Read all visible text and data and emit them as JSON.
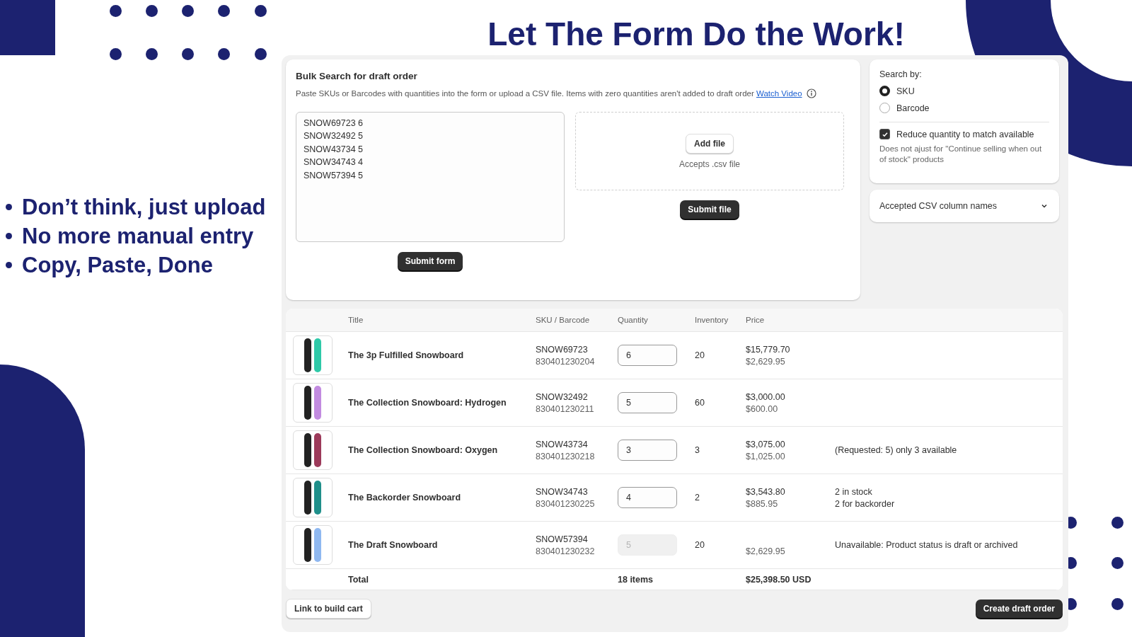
{
  "headline": "Let The Form Do the Work!",
  "bullets": [
    "Don’t think, just upload",
    "No more manual entry",
    "Copy, Paste, Done"
  ],
  "form_card": {
    "title": "Bulk Search for draft order",
    "description": "Paste SKUs or Barcodes with quantities into the form or upload a CSV file. Items with zero quantities aren't added to draft order",
    "link": "Watch Video",
    "textarea_lines": [
      "SNOW69723 6",
      "SNOW32492 5",
      "SNOW43734 5",
      "SNOW34743 4",
      "SNOW57394 5"
    ],
    "submit_form": "Submit form",
    "add_file": "Add file",
    "accepts": "Accepts .csv file",
    "submit_file": "Submit file"
  },
  "search_card": {
    "label": "Search by:",
    "options": [
      {
        "label": "SKU",
        "selected": true
      },
      {
        "label": "Barcode",
        "selected": false
      }
    ],
    "checkbox": {
      "label": "Reduce quantity to match available",
      "checked": true,
      "hint": "Does not ajust for \"Continue selling when out of stock\" products"
    }
  },
  "accordion": {
    "label": "Accepted CSV column names",
    "expanded": false
  },
  "table": {
    "columns": [
      "Title",
      "SKU / Barcode",
      "Quantity",
      "Inventory",
      "Price"
    ],
    "rows": [
      {
        "title": "The 3p Fulfilled Snowboard",
        "sku": "SNOW69723",
        "barcode": "830401230204",
        "quantity": "6",
        "disabled": false,
        "inventory": "20",
        "price_total": "$15,779.70",
        "price_unit": "$2,629.95",
        "notes": [],
        "color": "#2ec9a8"
      },
      {
        "title": "The Collection Snowboard: Hydrogen",
        "sku": "SNOW32492",
        "barcode": "830401230211",
        "quantity": "5",
        "disabled": false,
        "inventory": "60",
        "price_total": "$3,000.00",
        "price_unit": "$600.00",
        "notes": [],
        "color": "#c28be0"
      },
      {
        "title": "The Collection Snowboard: Oxygen",
        "sku": "SNOW43734",
        "barcode": "830401230218",
        "quantity": "3",
        "disabled": false,
        "inventory": "3",
        "price_total": "$3,075.00",
        "price_unit": "$1,025.00",
        "notes": [
          "(Requested: 5) only 3 available"
        ],
        "color": "#9c3a5a"
      },
      {
        "title": "The Backorder Snowboard",
        "sku": "SNOW34743",
        "barcode": "830401230225",
        "quantity": "4",
        "disabled": false,
        "inventory": "2",
        "price_total": "$3,543.80",
        "price_unit": "$885.95",
        "notes": [
          "2 in stock",
          "2 for backorder"
        ],
        "color": "#1f8f8a"
      },
      {
        "title": "The Draft Snowboard",
        "sku": "SNOW57394",
        "barcode": "830401230232",
        "quantity": "5",
        "disabled": true,
        "inventory": "20",
        "price_unit": "$2,629.95",
        "notes": [
          "Unavailable: Product status is draft or archived"
        ],
        "color": "#8fb8f0"
      }
    ],
    "total": {
      "label": "Total",
      "items": "18 items",
      "amount": "$25,398.50 USD"
    }
  },
  "footer": {
    "left_button": "Link to build cart",
    "right_button": "Create draft order"
  }
}
